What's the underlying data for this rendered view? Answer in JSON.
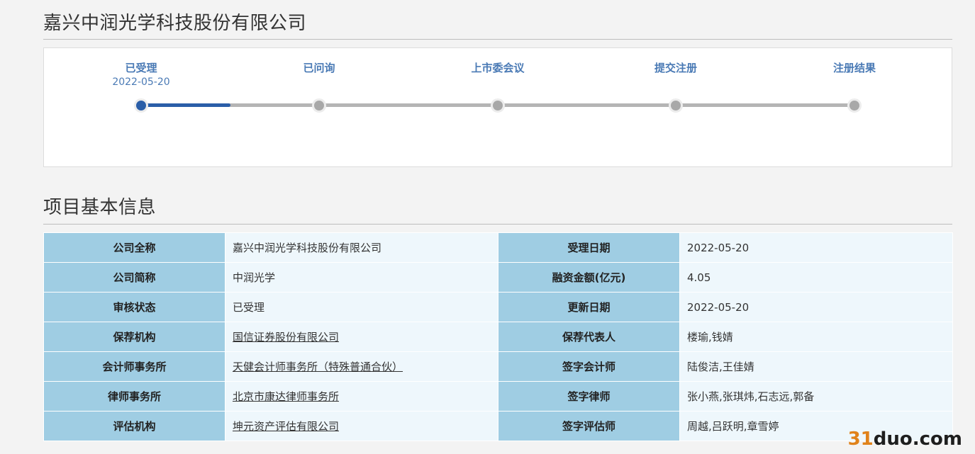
{
  "company": {
    "title": "嘉兴中润光学科技股份有限公司"
  },
  "progress": {
    "steps": [
      {
        "label": "已受理",
        "date": "2022-05-20"
      },
      {
        "label": "已问询"
      },
      {
        "label": "上市委会议"
      },
      {
        "label": "提交注册"
      },
      {
        "label": "注册结果"
      }
    ],
    "current_step": 1,
    "fill_fraction": 0.125,
    "colors": {
      "active": "#2a5ea8",
      "inactive": "#a8a8a8",
      "label": "#4a7ab5"
    }
  },
  "info": {
    "title": "项目基本信息",
    "rows": [
      {
        "k1": "公司全称",
        "v1": "嘉兴中润光学科技股份有限公司",
        "k2": "受理日期",
        "v2": "2022-05-20"
      },
      {
        "k1": "公司简称",
        "v1": "中润光学",
        "k2": "融资金额(亿元)",
        "v2": "4.05"
      },
      {
        "k1": "审核状态",
        "v1": "已受理",
        "k2": "更新日期",
        "v2": "2022-05-20"
      },
      {
        "k1": "保荐机构",
        "v1": "国信证券股份有限公司",
        "k2": "保荐代表人",
        "v2": "楼瑜,钱婧"
      },
      {
        "k1": "会计师事务所",
        "v1": "天健会计师事务所（特殊普通合伙）",
        "k2": "签字会计师",
        "v2": "陆俊洁,王佳婧"
      },
      {
        "k1": "律师事务所",
        "v1": "北京市康达律师事务所",
        "k2": "签字律师",
        "v2": "张小燕,张琪炜,石志远,郭备"
      },
      {
        "k1": "评估机构",
        "v1": "坤元资产评估有限公司",
        "k2": "签字评估师",
        "v2": "周越,吕跃明,章雪婷"
      }
    ]
  },
  "watermark": {
    "number": "31",
    "text": "duo.com"
  }
}
